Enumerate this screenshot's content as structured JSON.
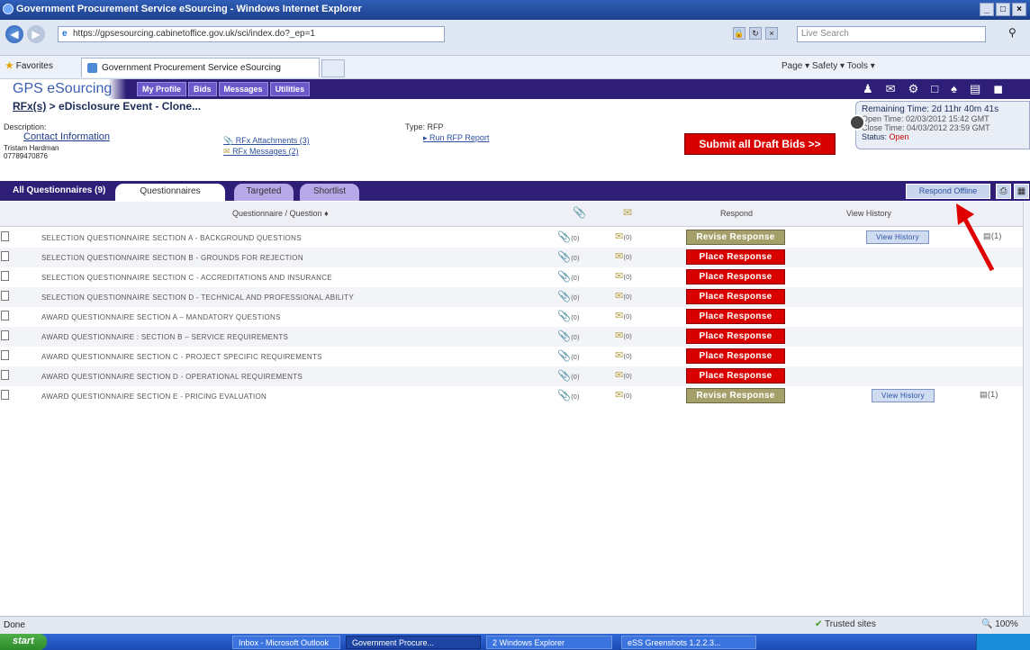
{
  "window": {
    "title": "Government Procurement Service eSourcing - Windows Internet Explorer",
    "controls": [
      "_",
      "□",
      "×"
    ]
  },
  "browser": {
    "url": "https://gpsesourcing.cabinetoffice.gov.uk/sci/index.do?_ep=1",
    "search_placeholder": "Live Search",
    "favorites_label": "Favorites",
    "tab_title": "Government Procurement Service eSourcing",
    "command_bar": "Page ▾   Safety ▾   Tools ▾",
    "status_left": "Done",
    "status_zone": "Trusted sites",
    "zoom": "100%"
  },
  "app": {
    "logo": "GPS eSourcing",
    "nav": [
      "My Profile",
      "Bids",
      "Messages",
      "Utilities"
    ],
    "breadcrumb_link": "RFx(s)",
    "breadcrumb_rest": " > eDisclosure Event - Clone...",
    "description_label": "Description:",
    "contact_link": "Contact Information",
    "contact_name": "Tristam Hardman",
    "contact_phone": "07789470876",
    "rfx_attachments": "RFx Attachments (3)",
    "rfx_messages": "RFx Messages (2)",
    "type_label": "Type:   RFP",
    "pdf_link": "Run RFP Report",
    "submit_label": "Submit all Draft Bids >>",
    "remaining": {
      "time": "Remaining Time: 2d 11hr 40m 41s",
      "open": "Open Time: 02/03/2012 15:42 GMT",
      "close": "Close Time: 04/03/2012 23:59 GMT",
      "status_label": "Status:",
      "status_value": "Open"
    }
  },
  "tabs": {
    "all_label": "All Questionnaires (9)",
    "items": [
      "Questionnaires",
      "Targeted",
      "Shortlist"
    ],
    "respond_offline": "Respond Offline"
  },
  "table": {
    "headers": {
      "question": "Questionnaire / Question",
      "respond": "Respond",
      "history": "View History"
    },
    "rows": [
      {
        "name": "SELECTION QUESTIONNAIRE SECTION A - BACKGROUND QUESTIONS",
        "att": "(0)",
        "msg": "(0)",
        "action": "Revise Response",
        "history": "View History",
        "count": "(1)"
      },
      {
        "name": "SELECTION QUESTIONNAIRE SECTION B - GROUNDS FOR REJECTION",
        "att": "(0)",
        "msg": "(0)",
        "action": "Place Response",
        "history": "",
        "count": ""
      },
      {
        "name": "SELECTION QUESTIONNAIRE SECTION C - ACCREDITATIONS AND INSURANCE",
        "att": "(0)",
        "msg": "(0)",
        "action": "Place Response",
        "history": "",
        "count": ""
      },
      {
        "name": "SELECTION QUESTIONNAIRE SECTION D - TECHNICAL AND PROFESSIONAL ABILITY",
        "att": "(0)",
        "msg": "(0)",
        "action": "Place Response",
        "history": "",
        "count": ""
      },
      {
        "name": "AWARD QUESTIONNAIRE SECTION A – MANDATORY QUESTIONS",
        "att": "(0)",
        "msg": "(0)",
        "action": "Place Response",
        "history": "",
        "count": ""
      },
      {
        "name": "AWARD QUESTIONNAIRE : SECTION B – SERVICE REQUIREMENTS",
        "att": "(0)",
        "msg": "(0)",
        "action": "Place Response",
        "history": "",
        "count": ""
      },
      {
        "name": "AWARD QUESTIONNAIRE SECTION C - PROJECT SPECIFIC REQUIREMENTS",
        "att": "(0)",
        "msg": "(0)",
        "action": "Place Response",
        "history": "",
        "count": ""
      },
      {
        "name": "AWARD QUESTIONNAIRE SECTION D - OPERATIONAL REQUIREMENTS",
        "att": "(0)",
        "msg": "(0)",
        "action": "Place Response",
        "history": "",
        "count": ""
      },
      {
        "name": "AWARD QUESTIONNAIRE SECTION E - PRICING EVALUATION",
        "att": "(0)",
        "msg": "(0)",
        "action": "Revise Response",
        "history": "View History",
        "count": "(1)"
      }
    ]
  },
  "taskbar": {
    "start": "start",
    "tasks": [
      "Inbox - Microsoft Outlook",
      "Government Procure...",
      "2 Windows Explorer",
      "eSS Greenshots 1.2.2.3..."
    ]
  },
  "colors": {
    "nav_bg": "#2e1e78",
    "place_btn": "#d90000",
    "revise_btn": "#a5a06a",
    "arrow": "#e00000"
  }
}
